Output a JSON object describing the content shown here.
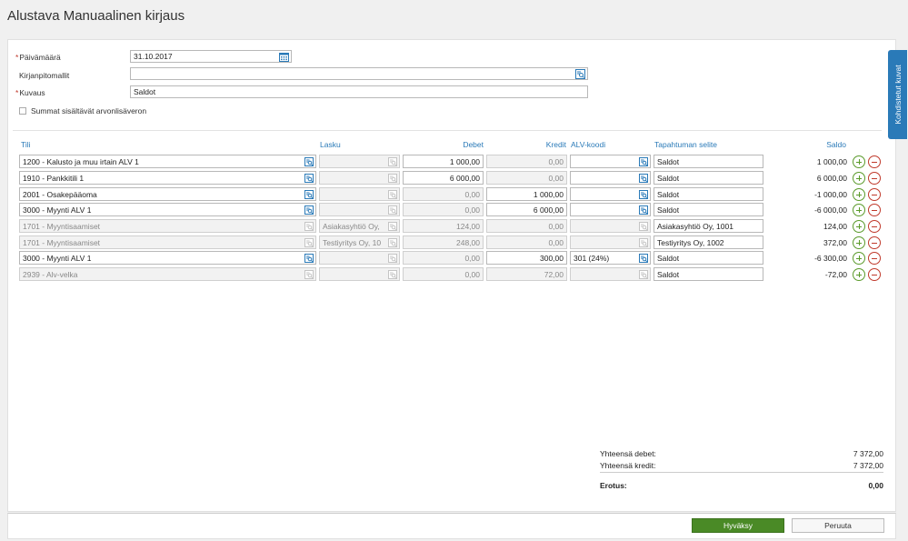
{
  "page": {
    "title": "Alustava Manuaalinen kirjaus"
  },
  "form": {
    "date_label": "Päivämäärä",
    "date_value": "31.10.2017",
    "template_label": "Kirjanpitomallit",
    "template_value": "",
    "description_label": "Kuvaus",
    "description_value": "Saldot",
    "vat_checkbox_label": "Summat sisältävät arvonlisäveron"
  },
  "table": {
    "headers": {
      "tili": "Tili",
      "lasku": "Lasku",
      "debet": "Debet",
      "kredit": "Kredit",
      "alv": "ALV-koodi",
      "selite": "Tapahtuman selite",
      "saldo": "Saldo"
    },
    "rows": [
      {
        "tili": "1200 - Kalusto ja muu irtain ALV 1",
        "lasku": "",
        "debet": "1 000,00",
        "kredit": "0,00",
        "alv": "",
        "selite": "Saldot",
        "saldo": "1 000,00"
      },
      {
        "tili": "1910 - Pankkitili 1",
        "lasku": "",
        "debet": "6 000,00",
        "kredit": "0,00",
        "alv": "",
        "selite": "Saldot",
        "saldo": "6 000,00"
      },
      {
        "tili": "2001 - Osakepääoma",
        "lasku": "",
        "debet": "0,00",
        "kredit": "1 000,00",
        "alv": "",
        "selite": "Saldot",
        "saldo": "-1 000,00"
      },
      {
        "tili": "3000 - Myynti ALV 1",
        "lasku": "",
        "debet": "0,00",
        "kredit": "6 000,00",
        "alv": "",
        "selite": "Saldot",
        "saldo": "-6 000,00"
      },
      {
        "tili": "1701 - Myyntisaamiset",
        "lasku": "Asiakasyhtiö Oy,",
        "debet": "124,00",
        "kredit": "0,00",
        "alv": "",
        "selite": "Asiakasyhtiö Oy, 1001",
        "saldo": "124,00"
      },
      {
        "tili": "1701 - Myyntisaamiset",
        "lasku": "Testiyritys Oy, 10",
        "debet": "248,00",
        "kredit": "0,00",
        "alv": "",
        "selite": "Testiyritys Oy, 1002",
        "saldo": "372,00"
      },
      {
        "tili": "3000 - Myynti ALV 1",
        "lasku": "",
        "debet": "0,00",
        "kredit": "300,00",
        "alv": "301 (24%)",
        "selite": "Saldot",
        "saldo": "-6 300,00"
      },
      {
        "tili": "2939 - Alv-velka",
        "lasku": "",
        "debet": "0,00",
        "kredit": "72,00",
        "alv": "",
        "selite": "Saldot",
        "saldo": "-72,00"
      }
    ]
  },
  "totals": {
    "debet_label": "Yhteensä debet:",
    "debet_value": "7 372,00",
    "kredit_label": "Yhteensä kredit:",
    "kredit_value": "7 372,00",
    "erotus_label": "Erotus:",
    "erotus_value": "0,00"
  },
  "buttons": {
    "accept": "Hyväksy",
    "cancel": "Peruuta"
  },
  "side_tab": {
    "label": "Kohdistetut kuvat"
  },
  "colors": {
    "accent": "#2a7ab8",
    "accept": "#4a8a26",
    "remove": "#c0392b"
  }
}
